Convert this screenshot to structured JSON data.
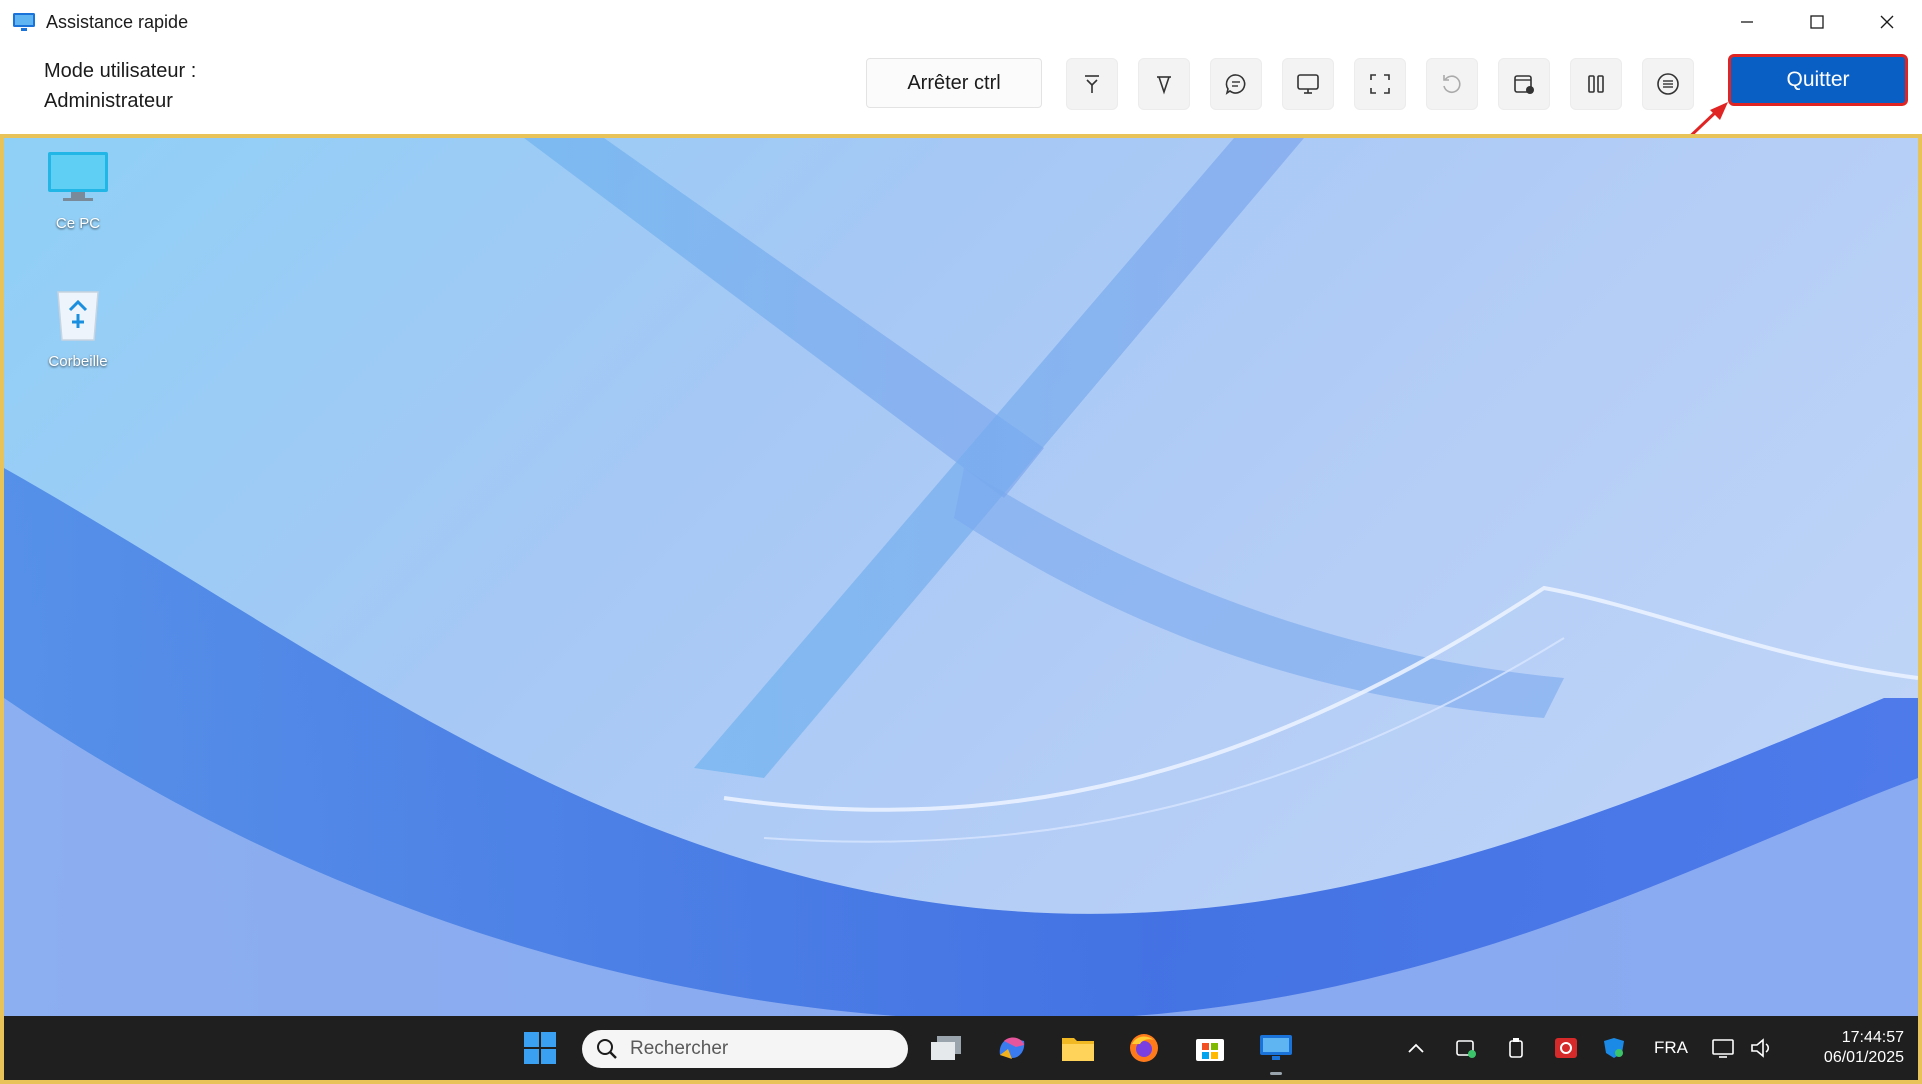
{
  "window": {
    "title": "Assistance rapide"
  },
  "toolbar": {
    "mode_label": "Mode utilisateur :",
    "mode_value": "Administrateur",
    "stop_ctrl_label": "Arrêter ctrl",
    "quit_label": "Quitter",
    "tools": [
      "laser-pointer-icon",
      "annotate-icon",
      "chat-icon",
      "select-monitor-icon",
      "fullscreen-icon",
      "restart-icon",
      "task-manager-icon",
      "pause-icon",
      "more-icon"
    ]
  },
  "desktop": {
    "icons": [
      {
        "label": "Ce PC",
        "icon": "computer-icon"
      },
      {
        "label": "Corbeille",
        "icon": "recycle-bin-icon"
      }
    ]
  },
  "taskbar": {
    "search_placeholder": "Rechercher",
    "language": "FRA",
    "time": "17:44:57",
    "date": "06/01/2025"
  },
  "colors": {
    "accent": "#0a5fc4",
    "highlight": "#e02424",
    "desktop_border": "#e8c35a",
    "taskbar": "#1f1f1f"
  }
}
